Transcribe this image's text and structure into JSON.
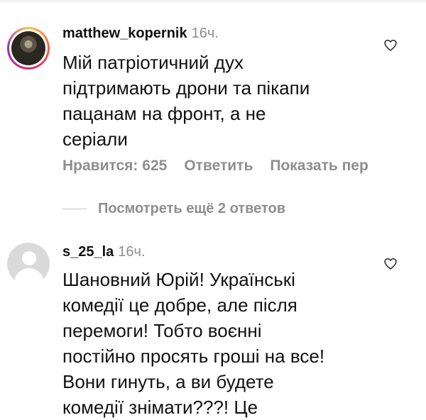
{
  "comments": [
    {
      "username": "matthew_kopernik",
      "time": "16ч.",
      "lines": [
        "Мій патріотичний дух",
        "підтримають дрони та пікапи",
        "пацанам на фронт, а не",
        "серіали"
      ],
      "likes_label": "Нравится: 625",
      "reply_label": "Ответить",
      "translate_label": "Показать пер",
      "avatar_icon": "story-avatar",
      "like_icon": "heart-outline"
    },
    {
      "username": "s_25_la",
      "time": "16ч.",
      "lines": [
        "Шановний Юрій! Українські",
        "комедії це добре, але після",
        "перемоги! Тобто воєнні",
        "постійно просять гроші на все!",
        "Вони гинуть, а ви будете",
        "комедії знімати???! Це"
      ],
      "avatar_icon": "default-avatar",
      "like_icon": "heart-outline"
    }
  ],
  "view_replies_label": "Посмотреть ещё 2 ответов",
  "colors": {
    "text": "#111111",
    "muted": "#8e8e8e",
    "background": "#ffffff"
  }
}
